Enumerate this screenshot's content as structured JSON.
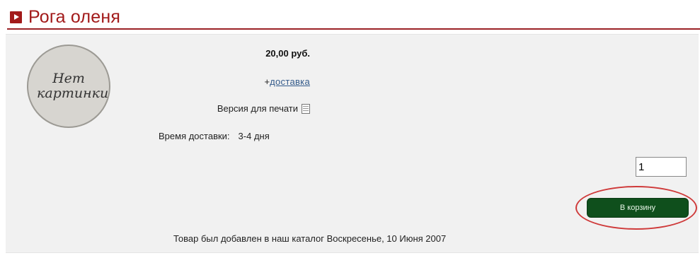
{
  "header": {
    "title": "Рога оленя",
    "icon": "play-arrow-icon"
  },
  "product": {
    "no_image_text": "Нет картинки",
    "price": "20,00 руб.",
    "delivery_prefix": "+",
    "delivery_link": "доставка",
    "print_label": "Версия для печати",
    "print_icon": "print-icon",
    "delivery_time_label": "Время доставки:",
    "delivery_time_value": "3-4 дня",
    "added_note": "Товар был добавлен в наш каталог Воскресенье, 10 Июня 2007"
  },
  "cart": {
    "quantity": "1",
    "button_label": "В корзину"
  },
  "colors": {
    "title": "#a21a1a",
    "button": "#0f4f1c",
    "highlight": "#cf3a3a"
  }
}
